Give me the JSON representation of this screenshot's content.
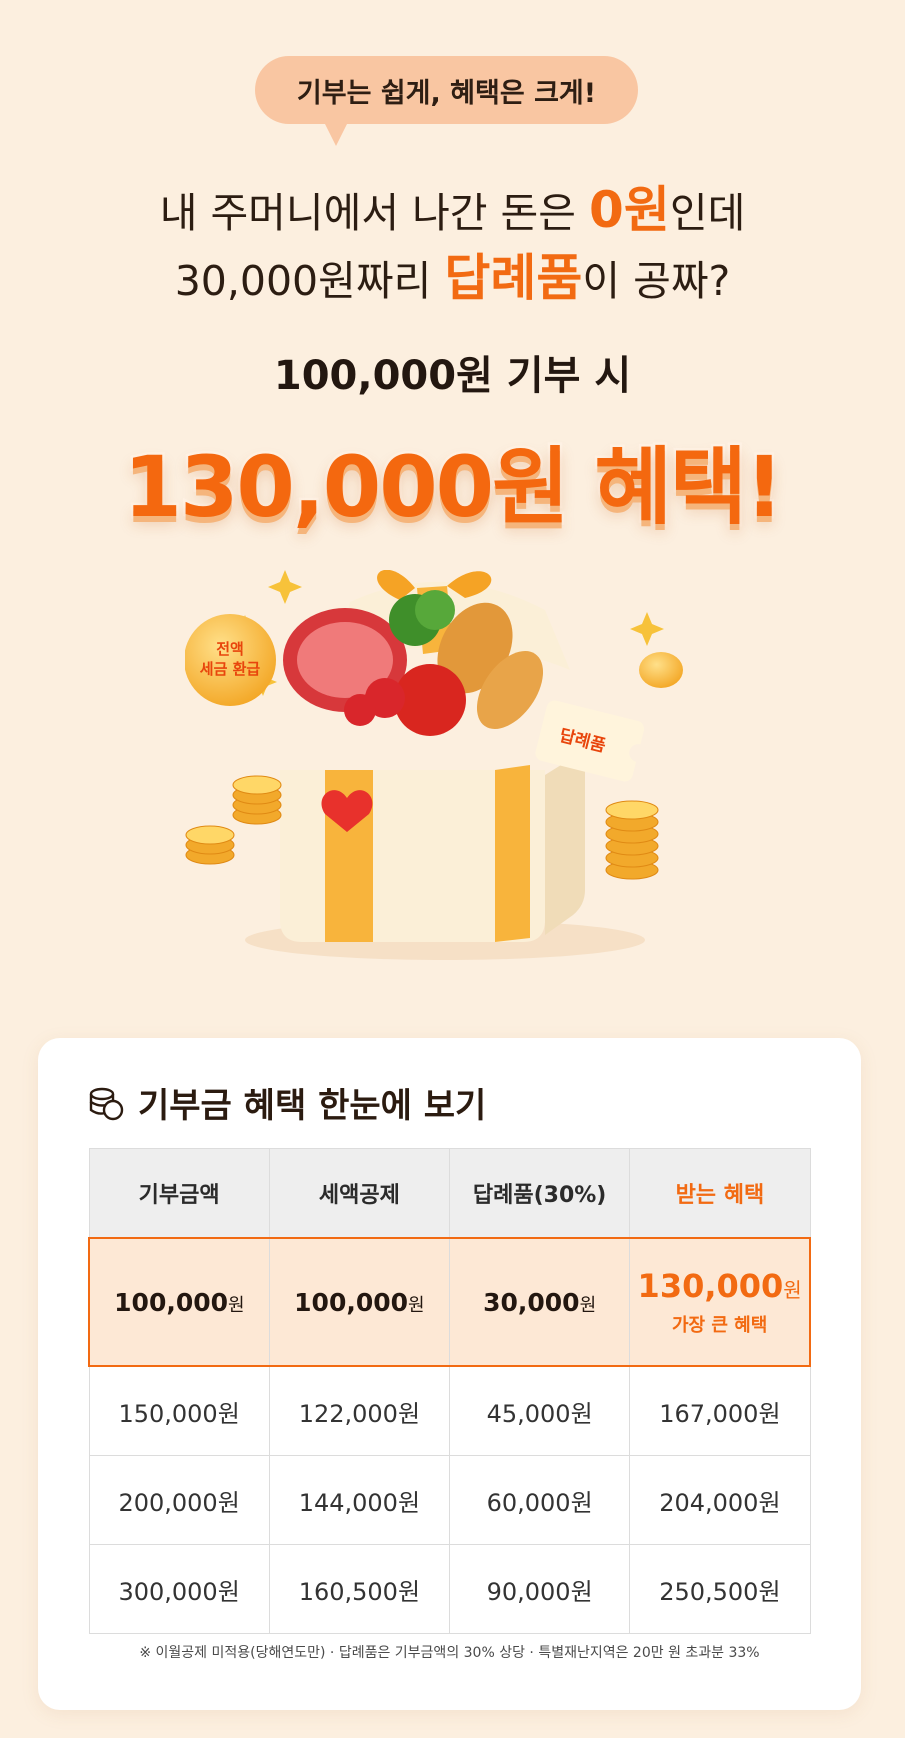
{
  "bubble": {
    "text": "기부는 쉽게, 혜택은 크게!"
  },
  "headline": {
    "line1_pre": "내 주머니에서 나간 돈은 ",
    "line1_hl": "0원",
    "line1_post": "인데",
    "line2_pre": "30,000원짜리 ",
    "line2_hl": "답례품",
    "line2_post": "이 공짜?",
    "line3": "100,000원 기부 시",
    "big": "130,000원 혜택!"
  },
  "illustration": {
    "coin_text_1": "전액",
    "coin_text_2": "세금 환급",
    "ticket_text": "답례품"
  },
  "card": {
    "title": "기부금 혜택 한눈에 보기",
    "headers": [
      "기부금액",
      "세액공제",
      "답례품(30%)",
      "받는 혜택"
    ],
    "highlight_row": {
      "values": [
        "100,000",
        "100,000",
        "30,000",
        "130,000"
      ],
      "unit": "원",
      "note": "가장 큰 혜택"
    },
    "rows": [
      [
        "150,000원",
        "122,000원",
        "45,000원",
        "167,000원"
      ],
      [
        "200,000원",
        "144,000원",
        "60,000원",
        "204,000원"
      ],
      [
        "300,000원",
        "160,500원",
        "90,000원",
        "250,500원"
      ]
    ],
    "footnote": "※ 이월공제 미적용(당해연도만) · 답례품은 기부금액의 30% 상당 · 특별재난지역은 20만 원 초과분 33%"
  },
  "colors": {
    "accent": "#f26a12",
    "background": "#fcefdf",
    "bubble": "#f9c6a2",
    "highlight_row": "#fde8d5"
  }
}
